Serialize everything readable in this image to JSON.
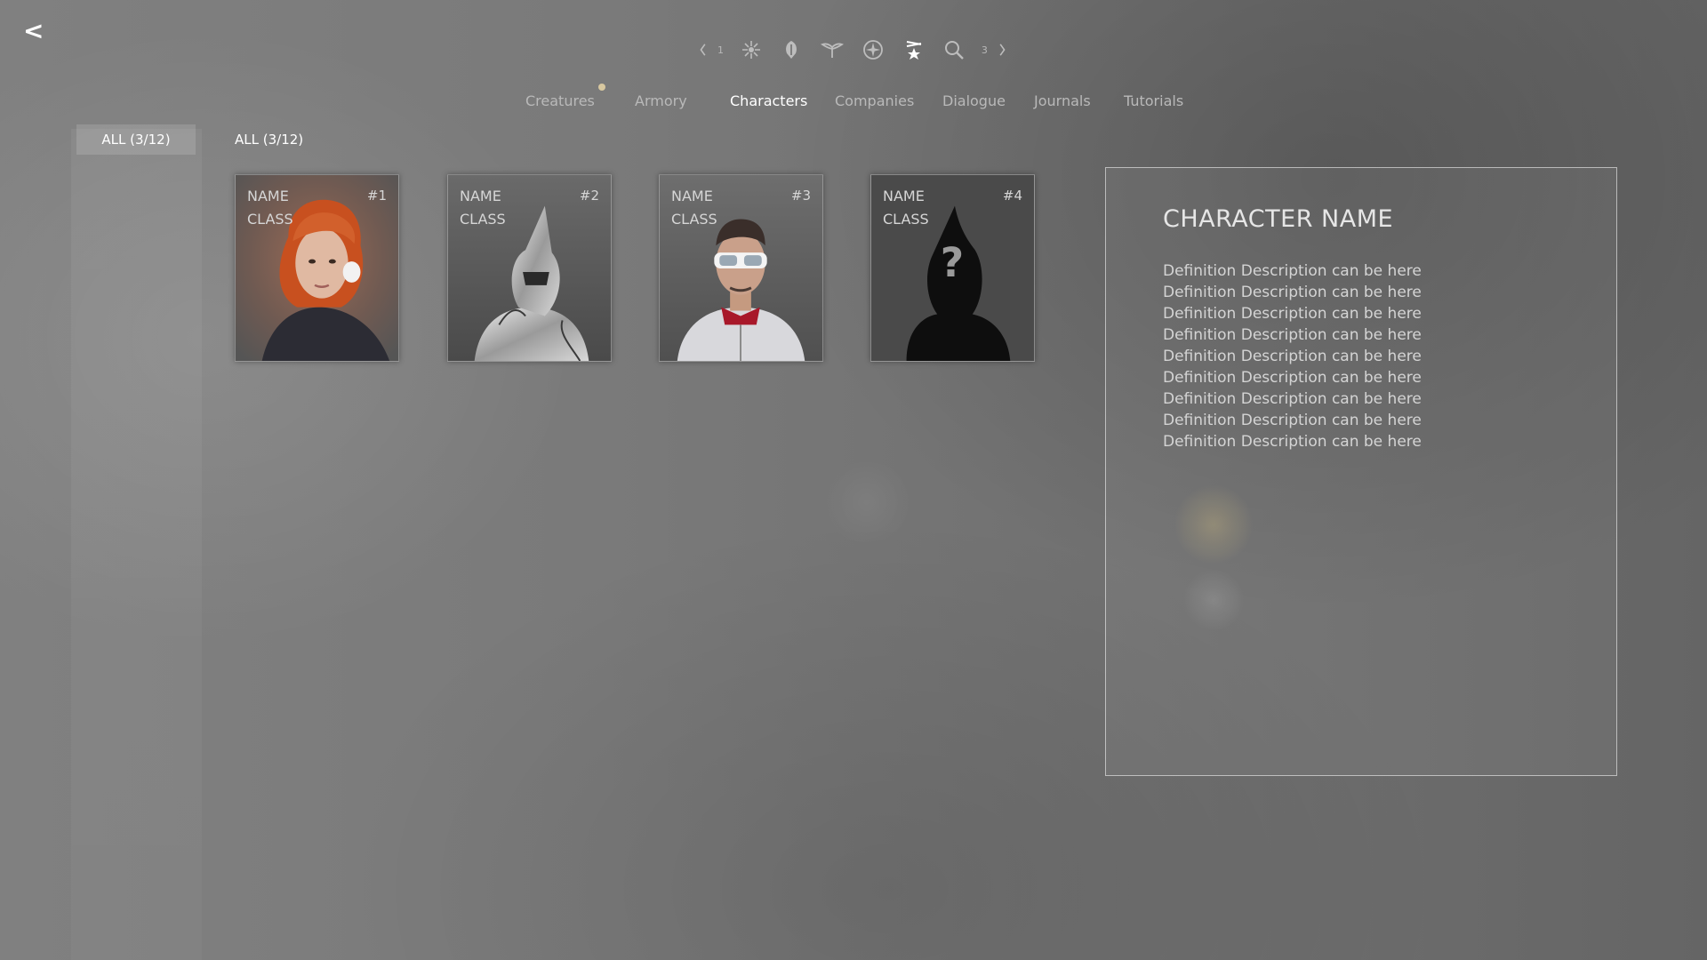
{
  "navigation": {
    "back_label": "<"
  },
  "category_icons": {
    "prev_page_label": "1",
    "next_page_label": "3",
    "icons": [
      "creatures-icon",
      "armory-icon",
      "leaf-emblem-icon",
      "wings-emblem-icon",
      "compass-icon",
      "characters-icon",
      "search-icon"
    ]
  },
  "tabs": [
    {
      "label": "Creatures",
      "active": false,
      "has_notification": true
    },
    {
      "label": "Armory",
      "active": false,
      "has_notification": false
    },
    {
      "label": "Characters",
      "active": true,
      "has_notification": false
    },
    {
      "label": "Companies",
      "active": false,
      "has_notification": false
    },
    {
      "label": "Dialogue",
      "active": false,
      "has_notification": false
    },
    {
      "label": "Journals",
      "active": false,
      "has_notification": false
    },
    {
      "label": "Tutorials",
      "active": false,
      "has_notification": false
    }
  ],
  "filters": {
    "side_filter_label": "ALL (3/12)",
    "grid_filter_label": "ALL (3/12)"
  },
  "cards": [
    {
      "name": "NAME",
      "class": "CLASS",
      "number": "#1",
      "portrait": "red-haired-woman",
      "locked": false
    },
    {
      "name": "NAME",
      "class": "CLASS",
      "number": "#2",
      "portrait": "armored-knight",
      "locked": false
    },
    {
      "name": "NAME",
      "class": "CLASS",
      "number": "#3",
      "portrait": "goggles-man",
      "locked": false
    },
    {
      "name": "NAME",
      "class": "CLASS",
      "number": "#4",
      "portrait": "unknown-silhouette",
      "locked": true
    }
  ],
  "detail": {
    "title": "CHARACTER NAME",
    "description_lines": [
      "Definition Description can be here",
      "Definition Description can be here",
      "Definition Description can be here",
      "Definition Description can be here",
      "Definition Description can be here",
      "Definition Description can be here",
      "Definition Description can be here",
      "Definition Description can be here",
      "Definition Description can be here"
    ]
  },
  "colors": {
    "active_text": "#ffffff",
    "inactive_text": "#b9b9b9",
    "notification_dot": "#d8c8a0",
    "panel_border": "#d9d9d9"
  }
}
